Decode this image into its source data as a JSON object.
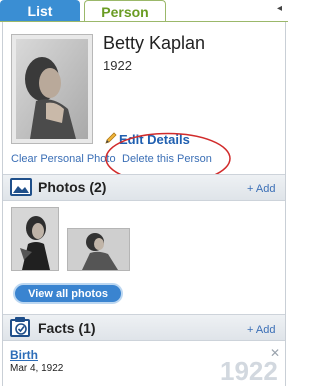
{
  "tabs": {
    "list": "List",
    "person": "Person",
    "arrow": "◂"
  },
  "person": {
    "name": "Betty Kaplan",
    "year": "1922"
  },
  "actions": {
    "edit_details": "Edit Details",
    "clear_photo": "Clear Personal Photo",
    "delete_person": "Delete this Person"
  },
  "photos": {
    "title": "Photos (2)",
    "add": "+ Add",
    "view_all": "View all photos"
  },
  "facts": {
    "title": "Facts (1)",
    "add": "+ Add",
    "items": [
      {
        "label": "Birth",
        "date": "Mar 4, 1922",
        "year": "1922",
        "close": "✕"
      }
    ]
  },
  "colors": {
    "tab_blue": "#3a8ed3",
    "person_green": "#6a9c23",
    "link_blue": "#3b6fb6",
    "annotation_red": "#d12b2b"
  }
}
